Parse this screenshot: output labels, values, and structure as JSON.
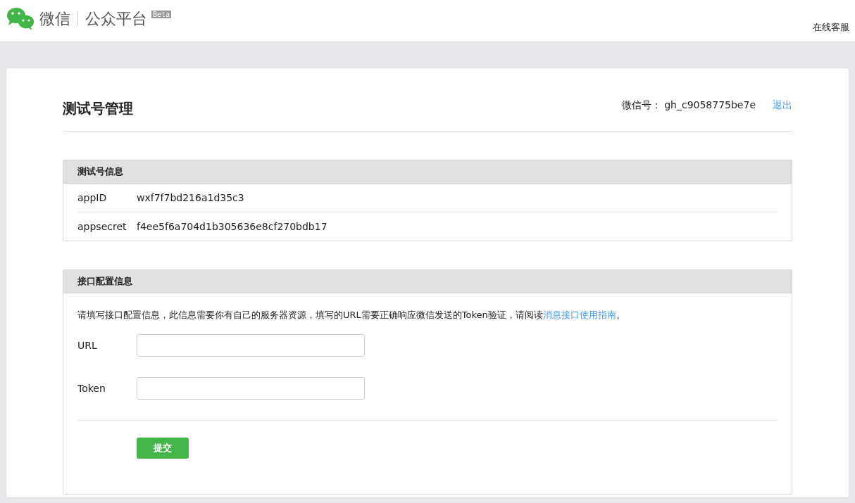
{
  "header": {
    "brand": "微信",
    "product": "公众平台",
    "badge": "Beta",
    "support_link": "在线客服"
  },
  "page": {
    "title": "测试号管理",
    "account_label": "微信号：",
    "account_id": "gh_c9058775be7e",
    "logout": "退出"
  },
  "info_panel": {
    "title": "测试号信息",
    "rows": [
      {
        "label": "appID",
        "value": "wxf7f7bd216a1d35c3"
      },
      {
        "label": "appsecret",
        "value": "f4ee5f6a704d1b305636e8cf270bdb17"
      }
    ]
  },
  "config_panel": {
    "title": "接口配置信息",
    "intro_before": "请填写接口配置信息，此信息需要你有自己的服务器资源，填写的URL需要正确响应微信发送的Token验证，请阅读",
    "intro_link": "消息接口使用指南",
    "intro_after": "。",
    "fields": [
      {
        "label": "URL"
      },
      {
        "label": "Token"
      }
    ],
    "submit": "提交"
  }
}
